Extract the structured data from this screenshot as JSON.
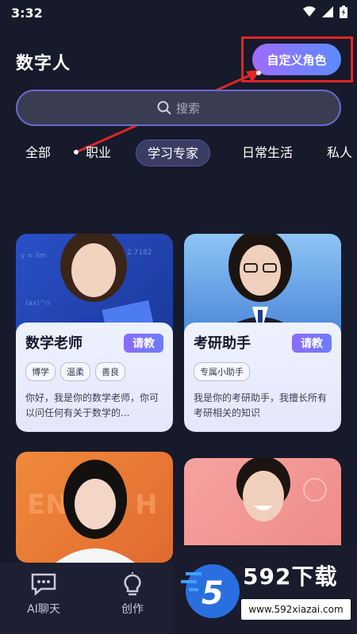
{
  "status": {
    "time": "3:32"
  },
  "header": {
    "title": "数字人",
    "custom_role_label": "自定义角色"
  },
  "search": {
    "placeholder": "搜索"
  },
  "tabs": [
    {
      "label": "全部"
    },
    {
      "label": "职业"
    },
    {
      "label": "学习专家",
      "active": true
    },
    {
      "label": "日常生活"
    },
    {
      "label": "私人"
    }
  ],
  "cards": [
    {
      "name": "数学老师",
      "ask_label": "请教",
      "tags": [
        "博学",
        "温柔",
        "善良"
      ],
      "desc": "你好，我是你的数学老师，你可以问任何有关于数学的..."
    },
    {
      "name": "考研助手",
      "ask_label": "请教",
      "tags": [
        "专属小助手"
      ],
      "desc": "我是你的考研助手，我擅长所有考研相关的知识"
    }
  ],
  "bottom_nav": [
    {
      "label": "AI聊天",
      "icon": "chat-icon"
    },
    {
      "label": "创作",
      "icon": "lightbulb-icon"
    }
  ],
  "watermark": {
    "brand": "592下载",
    "url": "www.592xiazai.com"
  },
  "colors": {
    "background": "#171a2a",
    "accent_start": "#a06bff",
    "accent_end": "#5b8cff",
    "highlight": "#e02626"
  }
}
